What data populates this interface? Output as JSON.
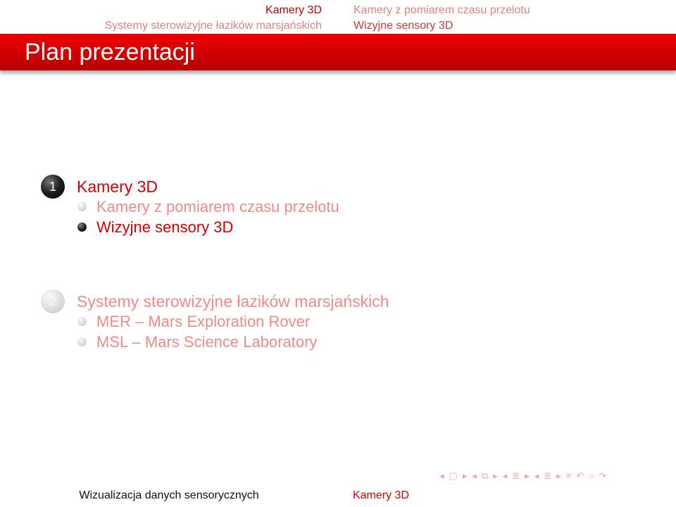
{
  "header": {
    "left_sections": [
      "Kamery 3D",
      "Systemy sterowizyjne łazików marsjańskich"
    ],
    "right_subsections": [
      "Kamery z pomiarem czasu przelotu",
      "Wizyjne sensory 3D"
    ]
  },
  "frame": {
    "title": "Plan prezentacji"
  },
  "toc": [
    {
      "number": "1",
      "title": "Kamery 3D",
      "items": [
        "Kamery z pomiarem czasu przelotu",
        "Wizyjne sensory 3D"
      ]
    },
    {
      "number": "2",
      "title": "Systemy sterowizyjne łazików marsjańskich",
      "items": [
        "MER – Mars Exploration Rover",
        "MSL – Mars Science Laboratory"
      ]
    }
  ],
  "footer": {
    "left": "Wizualizacja danych sensorycznych",
    "right": "Kamery 3D"
  },
  "nav_icons": [
    "first-slide-icon",
    "prev-frame-icon",
    "next-frame-icon",
    "prev-subsection-icon",
    "next-subsection-icon",
    "prev-section-icon",
    "next-section-icon",
    "toc-icon",
    "search-icon"
  ],
  "colors": {
    "title_bar": "#d40000",
    "active": "#d40000",
    "inactive": "#f08a8a"
  }
}
